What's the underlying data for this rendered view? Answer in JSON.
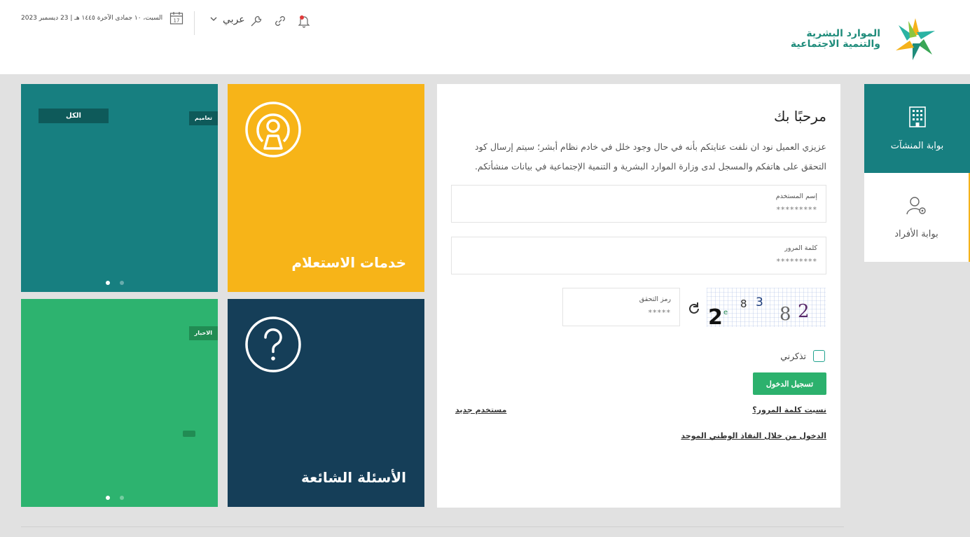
{
  "header": {
    "date": "السبت، ١٠ جمادى الآخرة ١٤٤٥ هـ | 23 ديسمبر 2023",
    "calendar_day": "17",
    "language": "عربي",
    "logo": {
      "line1": "الموارد البشرية",
      "line2": "والتنمية الاجتماعية"
    }
  },
  "portals": [
    {
      "label": "بوابة المنشآت",
      "active": true
    },
    {
      "label": "بوابة الأفراد",
      "active": false
    }
  ],
  "login": {
    "title": "مرحبًا بك",
    "intro": "عزيزي العميل نود ان نلفت عنايتكم بأنه في حال وجود خلل في خادم نظام أبشر؛ سيتم إرسال كود التحقق على هاتفكم والمسجل لدى وزارة الموارد البشرية و التنمية الإجتماعية في بيانات منشأتكم.",
    "username": {
      "label": "إسم المستخدم",
      "placeholder": "*********"
    },
    "password": {
      "label": "كلمة المرور",
      "placeholder": "*********"
    },
    "captcha": {
      "label": "رمز التحقق",
      "placeholder": "*****",
      "code": "2 8 3 8 2"
    },
    "remember_label": "تذكرني",
    "submit_label": "تسجيل الدخول",
    "forgot_label": "نسيت كلمة المرور؟",
    "new_user_label": "مستخدم جديد",
    "nafath_label": "الدخول من خلال النفاذ الوطني الموحد"
  },
  "tiles": {
    "news": {
      "tab_label": "الكل",
      "badge": "تعاميم",
      "active_dot": 0
    },
    "inquiry": {
      "title": "خدمات الاستعلام"
    },
    "announcements": {
      "badge": "الاخبار",
      "active_dot": 0
    },
    "faq": {
      "title": "الأسئلة الشائعة"
    }
  },
  "colors": {
    "teal": "#177f80",
    "yellow": "#f7b418",
    "green": "#2db36f",
    "navy": "#153e58",
    "button": "#2cb16d"
  }
}
